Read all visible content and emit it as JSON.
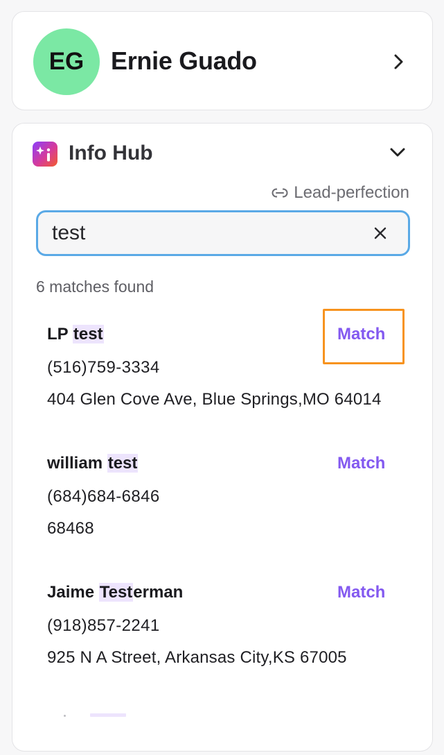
{
  "profile": {
    "initials": "EG",
    "name": "Ernie Guado",
    "avatar_color": "#7be8a4"
  },
  "info_hub": {
    "title": "Info Hub",
    "icon": "info-hub-sparkle-icon",
    "lead_link_label": "Lead-perfection",
    "search": {
      "value": "test",
      "placeholder": ""
    },
    "match_count": "6 matches found",
    "match_label": "Match",
    "accent_color": "#8359f0",
    "highlight_color": "#ede4fd",
    "results": [
      {
        "name_prefix": "LP ",
        "name_highlight": "test",
        "name_suffix": "",
        "phone": "(516)759-3334",
        "address": "404 Glen Cove Ave, Blue Springs,MO 64014"
      },
      {
        "name_prefix": "william ",
        "name_highlight": "test",
        "name_suffix": "",
        "phone": "(684)684-6846",
        "address": "68468"
      },
      {
        "name_prefix": "Jaime ",
        "name_highlight": "Test",
        "name_suffix": "erman",
        "phone": "(918)857-2241",
        "address": "925 N A Street, Arkansas City,KS 67005"
      }
    ]
  }
}
